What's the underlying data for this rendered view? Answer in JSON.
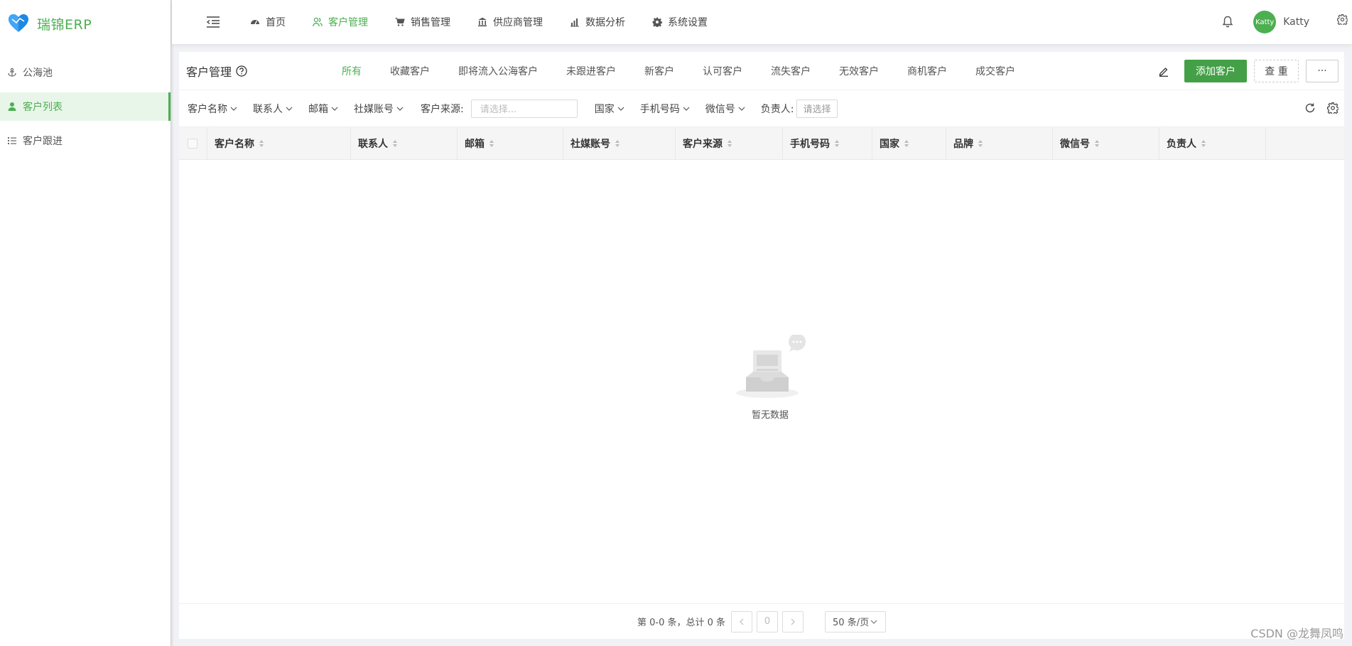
{
  "app": {
    "logo_text": "瑞锦ERP",
    "accent": "#4caf50"
  },
  "sidebar": {
    "items": [
      {
        "label": "公海池",
        "icon": "anchor-icon"
      },
      {
        "label": "客户列表",
        "icon": "user-icon",
        "active": true
      },
      {
        "label": "客户跟进",
        "icon": "list-icon"
      }
    ]
  },
  "topnav": {
    "items": [
      {
        "label": "首页",
        "icon": "dashboard-icon"
      },
      {
        "label": "客户管理",
        "icon": "users-icon",
        "active": true
      },
      {
        "label": "销售管理",
        "icon": "cart-icon"
      },
      {
        "label": "供应商管理",
        "icon": "bank-icon"
      },
      {
        "label": "数据分析",
        "icon": "bar-chart-icon"
      },
      {
        "label": "系统设置",
        "icon": "gear-icon"
      }
    ],
    "user": {
      "avatar_text": "Katty",
      "name": "Katty"
    }
  },
  "page": {
    "title": "客户管理",
    "tabs": [
      "所有",
      "收藏客户",
      "即将流入公海客户",
      "未跟进客户",
      "新客户",
      "认可客户",
      "流失客户",
      "无效客户",
      "商机客户",
      "成交客户"
    ],
    "actions": {
      "add": "添加客户",
      "reset": "查 重",
      "more": "···"
    }
  },
  "filters": {
    "dropdowns_left": [
      "客户名称",
      "联系人",
      "邮箱",
      "社媒账号"
    ],
    "source_label": "客户来源:",
    "source_placeholder": "请选择...",
    "dropdowns_right": [
      "国家",
      "手机号码",
      "微信号"
    ],
    "owner_label": "负责人:",
    "owner_placeholder": "请选择"
  },
  "table": {
    "columns": [
      "客户名称",
      "联系人",
      "邮箱",
      "社媒账号",
      "客户来源",
      "手机号码",
      "国家",
      "品牌",
      "微信号",
      "负责人"
    ],
    "rows": [],
    "empty_text": "暂无数据"
  },
  "pagination": {
    "total_text": "第 0-0 条，总计 0 条",
    "current_page": "0",
    "page_size": "50 条/页"
  },
  "watermark": "CSDN @龙舞凤鸣"
}
